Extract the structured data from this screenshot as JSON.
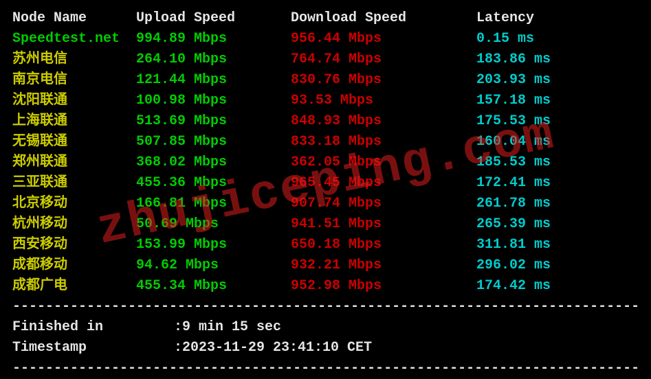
{
  "chart_data": {
    "type": "table",
    "columns": [
      "Node Name",
      "Upload Speed",
      "Download Speed",
      "Latency"
    ],
    "rows": [
      {
        "node": "Speedtest.net",
        "upload": "994.89 Mbps",
        "download": "956.44 Mbps",
        "latency": "0.15 ms",
        "highlight": true
      },
      {
        "node": "苏州电信",
        "upload": "264.10 Mbps",
        "download": "764.74 Mbps",
        "latency": "183.86 ms"
      },
      {
        "node": "南京电信",
        "upload": "121.44 Mbps",
        "download": "830.76 Mbps",
        "latency": "203.93 ms"
      },
      {
        "node": "沈阳联通",
        "upload": "100.98 Mbps",
        "download": "93.53 Mbps",
        "latency": "157.18 ms"
      },
      {
        "node": "上海联通",
        "upload": "513.69 Mbps",
        "download": "848.93 Mbps",
        "latency": "175.53 ms"
      },
      {
        "node": "无锡联通",
        "upload": "507.85 Mbps",
        "download": "833.18 Mbps",
        "latency": "160.04 ms"
      },
      {
        "node": "郑州联通",
        "upload": "368.02 Mbps",
        "download": "362.05 Mbps",
        "latency": "185.53 ms"
      },
      {
        "node": "三亚联通",
        "upload": "455.36 Mbps",
        "download": "965.45 Mbps",
        "latency": "172.41 ms"
      },
      {
        "node": "北京移动",
        "upload": "166.81 Mbps",
        "download": "907.74 Mbps",
        "latency": "261.78 ms"
      },
      {
        "node": "杭州移动",
        "upload": "50.69 Mbps",
        "download": "941.51 Mbps",
        "latency": "265.39 ms"
      },
      {
        "node": "西安移动",
        "upload": "153.99 Mbps",
        "download": "650.18 Mbps",
        "latency": "311.81 ms"
      },
      {
        "node": "成都移动",
        "upload": "94.62 Mbps",
        "download": "932.21 Mbps",
        "latency": "296.02 ms"
      },
      {
        "node": "成都广电",
        "upload": "455.34 Mbps",
        "download": "952.98 Mbps",
        "latency": "174.42 ms"
      }
    ]
  },
  "headers": {
    "node": "Node Name",
    "upload": "Upload Speed",
    "download": "Download Speed",
    "latency": "Latency"
  },
  "divider": "----------------------------------------------------------------------------",
  "footer": {
    "finished_label": "Finished in",
    "finished_value": "9 min 15 sec",
    "timestamp_label": "Timestamp",
    "timestamp_value": "2023-11-29 23:41:10 CET",
    "sep": ": "
  },
  "watermark": "zhujiceping.com",
  "colors": {
    "upload": "#00cc00",
    "download": "#cc0000",
    "latency": "#00cccc",
    "node_default": "#cccc00",
    "header": "#e5e5e5"
  }
}
